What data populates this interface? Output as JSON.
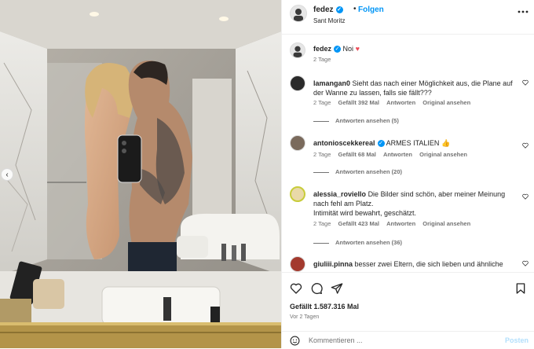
{
  "post": {
    "username": "fedez",
    "follow_label": "Folgen",
    "separator": "•",
    "location": "Sant Moritz",
    "caption": "Noi",
    "caption_age": "2 Tage",
    "likes": "Gefällt 1.587.316 Mal",
    "age": "Vor 2 Tagen"
  },
  "comments": [
    {
      "user": "lamangan0",
      "text": "Sieht das nach einer Möglichkeit aus, die Plane auf der Wanne zu lassen, falls sie fällt???",
      "age": "2 Tage",
      "likes": "Gefällt 392 Mal",
      "reply": "Antworten",
      "translate": "Original ansehen",
      "replies": "Antworten ansehen (5)"
    },
    {
      "user": "antonioscekkereal",
      "text": "ARMES ITALIEN",
      "age": "2 Tage",
      "likes": "Gefällt 68 Mal",
      "reply": "Antworten",
      "translate": "Original ansehen",
      "replies": "Antworten ansehen (20)"
    },
    {
      "user": "alessia_roviello",
      "text": "Die Bilder sind schön, aber meiner Meinung nach fehl am Platz.",
      "text2": "Intimität wird bewahrt, geschätzt.",
      "age": "2 Tage",
      "likes": "Gefällt 423 Mal",
      "reply": "Antworten",
      "translate": "Original ansehen",
      "replies": "Antworten ansehen (36)"
    },
    {
      "user": "giuliii.pinna",
      "text": "besser zwei Eltern, die sich lieben und ähnliche"
    }
  ],
  "composer": {
    "placeholder": "Kommentieren ...",
    "post_label": "Posten"
  },
  "icons": {
    "verified": "verified-badge-icon",
    "more": "more-options-icon",
    "like": "heart-icon",
    "comment": "comment-icon",
    "share": "paper-plane-icon",
    "save": "bookmark-icon",
    "emoji": "emoji-icon",
    "carousel_prev": "chevron-left-icon"
  },
  "colors": {
    "accent": "#0095f6",
    "heart": "#ed4956",
    "muted": "#737373",
    "text": "#262626"
  }
}
